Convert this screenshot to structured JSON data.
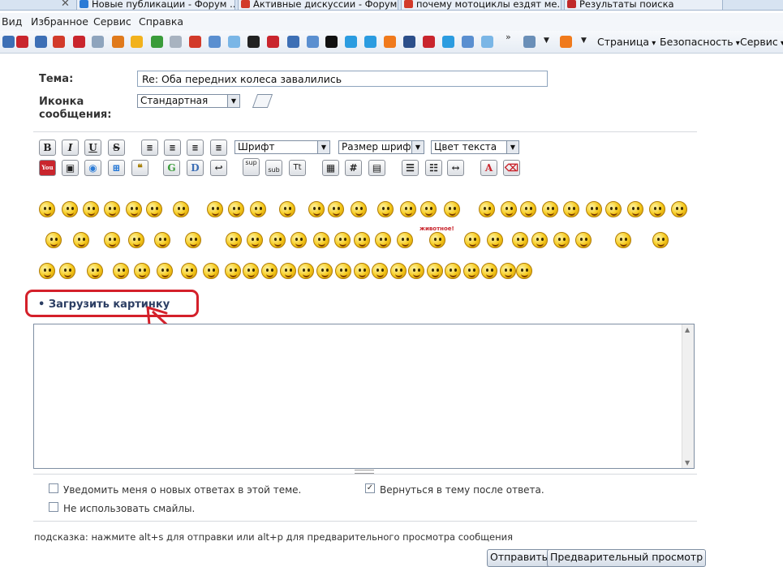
{
  "browser": {
    "tabs": [
      {
        "title": "Новые публикации - Форум ...",
        "color": "#2b7bd6"
      },
      {
        "title": "Активные дискуссии - Форум...",
        "color": "#d23a2a"
      },
      {
        "title": "почему мотоциклы ездят ме...",
        "color": "#d23a2a"
      },
      {
        "title": "Результаты поиска",
        "color": "#c0282a"
      }
    ],
    "menu": {
      "view": "Вид",
      "favorites": "Избранное",
      "service": "Сервис",
      "help": "Справка"
    },
    "commands": {
      "page": "Страница",
      "security": "Безопасность",
      "service": "Сервис"
    }
  },
  "form": {
    "subject_label": "Тема:",
    "subject_value": "Re: Оба передних колеса завалились",
    "icon_label_1": "Иконка",
    "icon_label_2": "сообщения:",
    "icon_value": "Стандартная"
  },
  "editor": {
    "buttons": [
      "B",
      "I",
      "U",
      "S"
    ],
    "font_select": "Шрифт",
    "size_select": "Размер шрифта",
    "color_select": "Цвет текста",
    "sup": "sup",
    "sub": "sub",
    "tt": "Tt",
    "hash": "#"
  },
  "smilies_banner": "животное!",
  "upload_link": "• Загрузить картинку",
  "annotation_color": "#d4202a",
  "options": {
    "notify": "Уведомить меня о новых ответах в этой теме.",
    "no_smilies": "Не использовать смайлы.",
    "return": "Вернуться в тему после ответа.",
    "return_checked": "✓"
  },
  "hint": "подсказка: нажмите alt+s для отправки или alt+p для предварительного просмотра сообщения",
  "actions": {
    "submit": "Отправить",
    "preview": "Предварительный просмотр"
  }
}
